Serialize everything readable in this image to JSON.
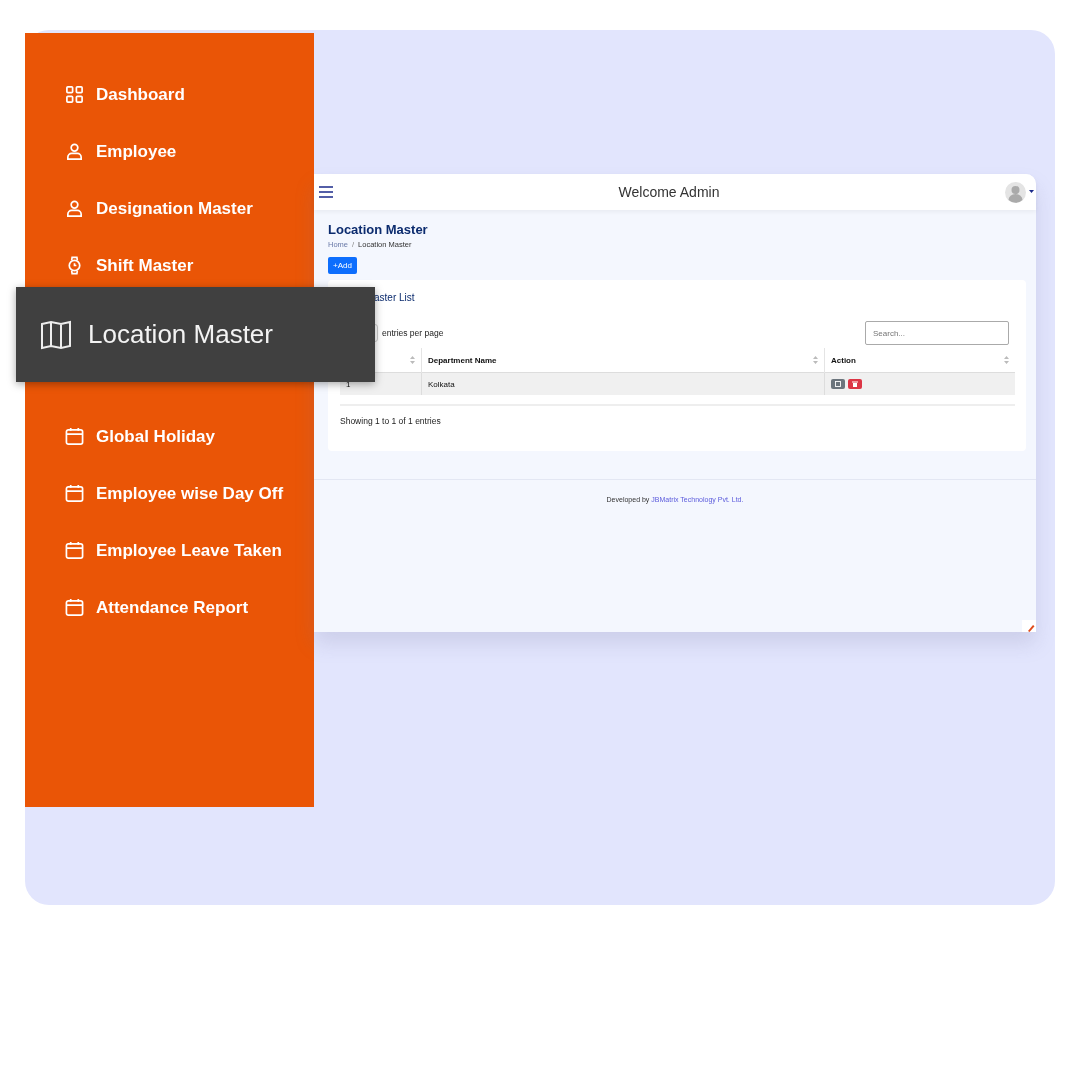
{
  "sidebar": {
    "items": [
      {
        "label": "Dashboard",
        "kind": "grid"
      },
      {
        "label": "Employee",
        "kind": "person"
      },
      {
        "label": "Designation Master",
        "kind": "person"
      },
      {
        "label": "Shift Master",
        "kind": "watch"
      },
      {
        "label": "Global Holiday",
        "kind": "calendar"
      },
      {
        "label": "Employee wise Day Off",
        "kind": "calendar"
      },
      {
        "label": "Employee Leave Taken",
        "kind": "calendar"
      },
      {
        "label": "Attendance Report",
        "kind": "calendar"
      }
    ],
    "highlight": {
      "label": "Location Master"
    }
  },
  "header": {
    "title": "Welcome Admin"
  },
  "page": {
    "title": "Location Master",
    "breadcrumb": [
      "Home",
      "Location Master"
    ],
    "breadcrumb_separator": "/",
    "add_button": "+Add"
  },
  "card": {
    "title": "aster List",
    "entries_label": "entries per page",
    "search": {
      "placeholder": "Search..."
    },
    "table": {
      "columns": [
        "",
        "Department Name",
        "Action"
      ],
      "rows": [
        {
          "cells": [
            "1",
            "Kolkata"
          ]
        }
      ]
    },
    "info": "Showing 1 to 1 of 1 entries"
  },
  "footer": {
    "text": "Developed by",
    "link": "JBMatrix Technology Pvt. Ltd."
  }
}
